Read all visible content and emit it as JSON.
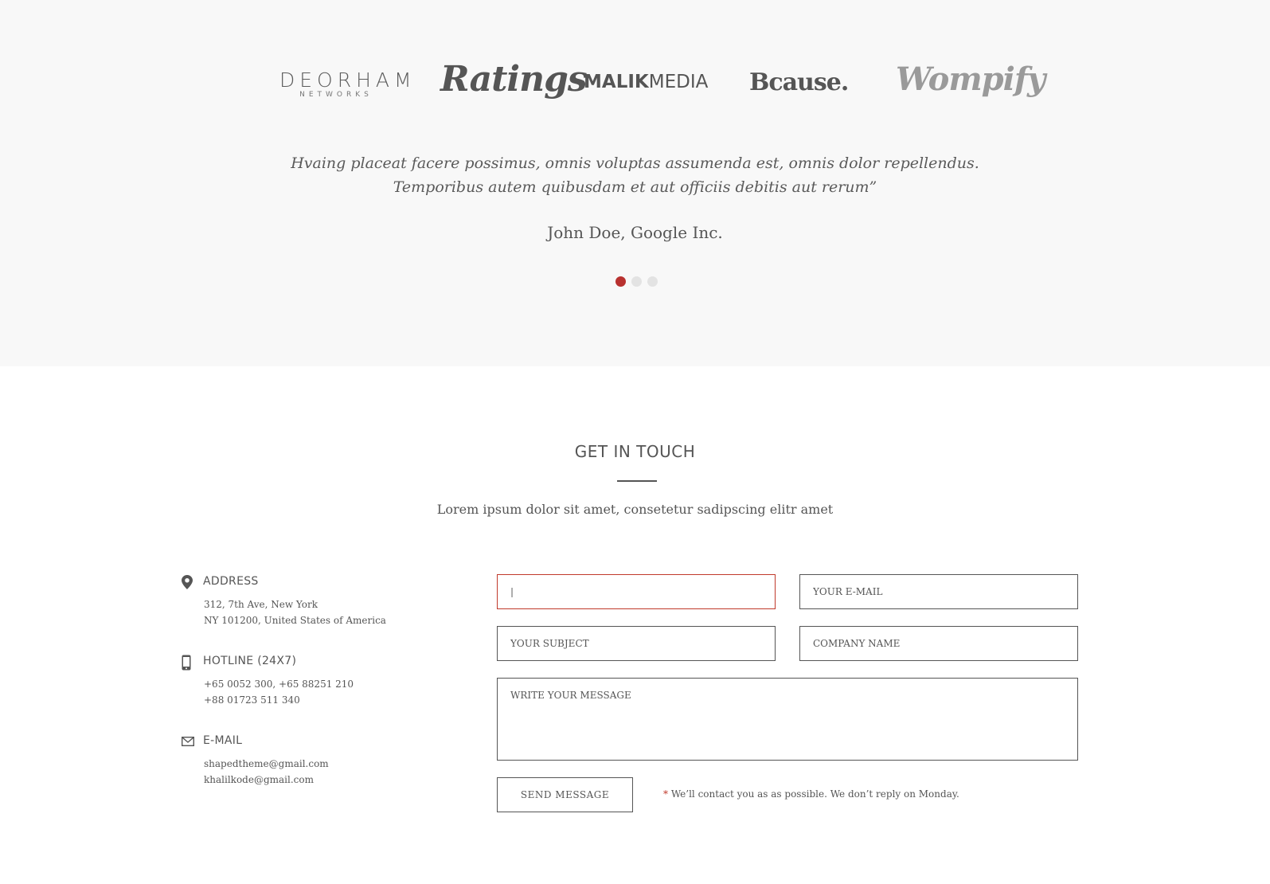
{
  "logos": {
    "deorham_main": "DEORHAM",
    "deorham_sub": "NETWORKS",
    "ratings": "Ratings",
    "malik_bold": "MALIK",
    "malik_light": "MEDIA",
    "bcause": "Bcause.",
    "wompify": "Wompify"
  },
  "testimonial": {
    "quote_line1": "Hvaing placeat facere possimus, omnis voluptas assumenda est, omnis dolor repellendus.",
    "quote_line2": "Temporibus autem quibusdam et aut officiis debitis aut rerum”",
    "author": "John Doe, Google Inc.",
    "active_slide": 1,
    "slide_count": 3
  },
  "contact": {
    "heading": "GET IN TOUCH",
    "subheading": "Lorem ipsum dolor sit amet, consetetur sadipscing elitr amet",
    "address": {
      "title": "ADDRESS",
      "line1": "312, 7th Ave, New York",
      "line2": "NY 101200, United States of America"
    },
    "hotline": {
      "title": "HOTLINE (24X7)",
      "line1": "+65 0052 300, +65 88251 210",
      "line2": "+88 01723 511 340"
    },
    "email": {
      "title": "E-MAIL",
      "line1": "shapedtheme@gmail.com",
      "line2": "khalilkode@gmail.com"
    }
  },
  "form": {
    "name_value": "|",
    "email_placeholder": "YOUR E-MAIL",
    "subject_placeholder": "YOUR SUBJECT",
    "company_placeholder": "COMPANY NAME",
    "message_placeholder": "WRITE YOUR MESSAGE",
    "send_label": "SEND MESSAGE",
    "note_star": "*",
    "note_text": " We’ll contact you as as possible. We don’t reply on Monday."
  },
  "colors": {
    "accent": "#b8312f",
    "band_bg": "#f8f8f8",
    "text": "#555555"
  }
}
